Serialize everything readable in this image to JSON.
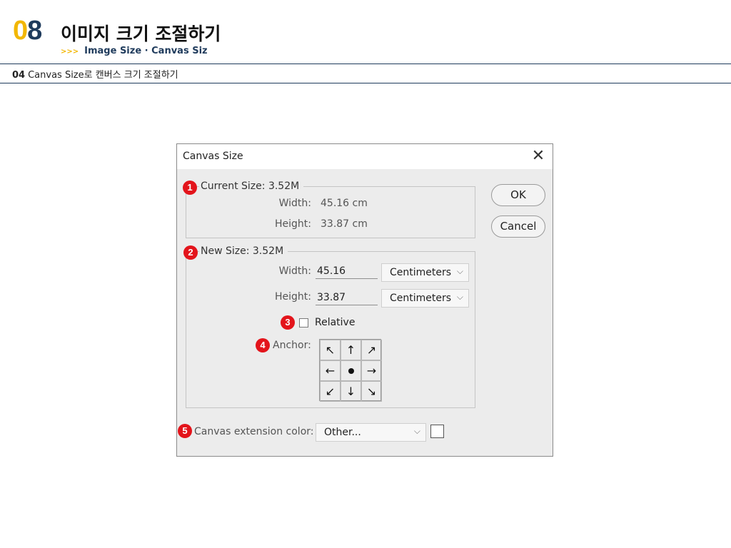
{
  "header": {
    "chapter_num_first": "0",
    "chapter_num_second": "8",
    "chapter_title": "이미지 크기 조절하기",
    "subtitle_arrows": ">>>",
    "subtitle": "Image Size · Canvas Siz",
    "section_num": "04",
    "section_title": "Canvas Size로 캔버스 크기 조절하기"
  },
  "dialog": {
    "title": "Canvas Size",
    "close_icon": "close-icon",
    "ok_label": "OK",
    "cancel_label": "Cancel",
    "current_size": {
      "legend": "Current Size: 3.52M",
      "width_label": "Width:",
      "width_value": "45.16 cm",
      "height_label": "Height:",
      "height_value": "33.87 cm"
    },
    "new_size": {
      "legend": "New Size: 3.52M",
      "width_label": "Width:",
      "width_value": "45.16",
      "width_unit": "Centimeters",
      "height_label": "Height:",
      "height_value": "33.87",
      "height_unit": "Centimeters",
      "relative_label": "Relative",
      "relative_checked": false,
      "anchor_label": "Anchor:",
      "anchor_cells": [
        "↖",
        "↑",
        "↗",
        "←",
        "",
        "→",
        "↙",
        "↓",
        "↘"
      ]
    },
    "extension_color": {
      "label": "Canvas extension color:",
      "value": "Other...",
      "swatch_color": "#ffffff"
    }
  },
  "badges": [
    "1",
    "2",
    "3",
    "4",
    "5"
  ],
  "colors": {
    "accent_yellow": "#f2b705",
    "brand_navy": "#1f3b5c",
    "badge_red": "#e3141b",
    "dialog_bg": "#ececec"
  }
}
